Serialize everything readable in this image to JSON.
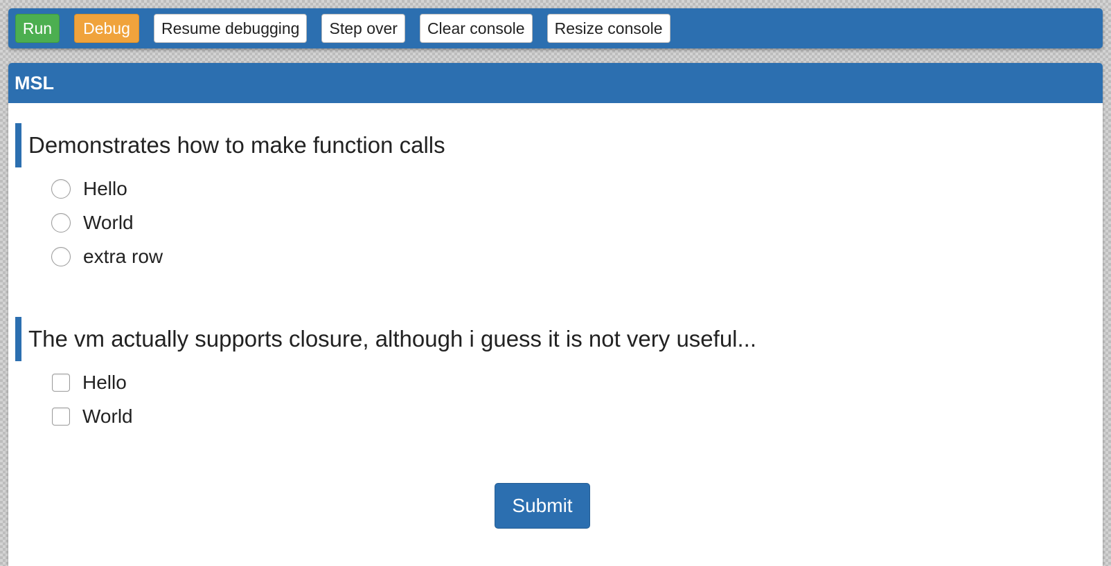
{
  "toolbar": {
    "run_label": "Run",
    "debug_label": "Debug",
    "resume_label": "Resume debugging",
    "step_over_label": "Step over",
    "clear_console_label": "Clear console",
    "resize_console_label": "Resize console"
  },
  "panel": {
    "title": "MSL",
    "questions": [
      {
        "text": "Demonstrates how to make function calls",
        "type": "radio",
        "options": [
          {
            "label": "Hello"
          },
          {
            "label": "World"
          },
          {
            "label": "extra row"
          }
        ]
      },
      {
        "text": "The vm actually supports closure, although i guess it is not very useful...",
        "type": "checkbox",
        "options": [
          {
            "label": "Hello"
          },
          {
            "label": "World"
          }
        ]
      }
    ],
    "submit_label": "Submit"
  },
  "colors": {
    "primary": "#2c6fb0",
    "run": "#4caf50",
    "debug": "#f0a33c"
  }
}
